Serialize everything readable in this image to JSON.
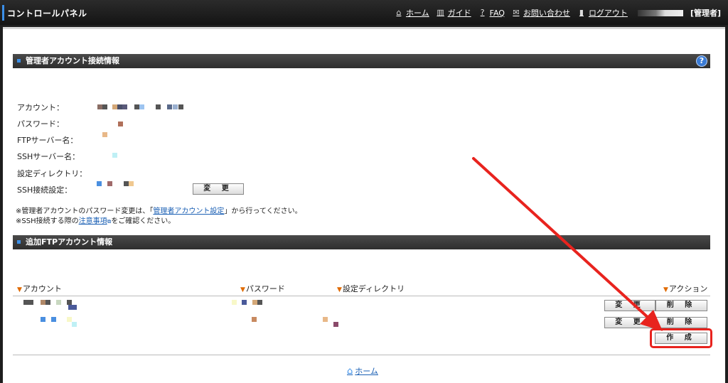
{
  "header": {
    "title": "コントロールパネル",
    "nav": [
      {
        "icon": "home-icon",
        "glyph": "⌂",
        "label": "ホーム"
      },
      {
        "icon": "book-icon",
        "glyph": "▥",
        "label": "ガイド"
      },
      {
        "icon": "help-circle-icon",
        "glyph": "?",
        "label": "FAQ"
      },
      {
        "icon": "mail-icon",
        "glyph": "✉",
        "label": "お問い合わせ"
      },
      {
        "icon": "logout-icon",
        "glyph": "▮",
        "label": "ログアウト"
      }
    ],
    "role": "[管理者]"
  },
  "admin_section": {
    "title": "管理者アカウント接続情報",
    "help_glyph": "?",
    "fields": [
      {
        "label": "アカウント："
      },
      {
        "label": "パスワード："
      },
      {
        "label": "FTPサーバー名："
      },
      {
        "label": "SSHサーバー名："
      },
      {
        "label": "設定ディレクトリ："
      },
      {
        "label": "SSH接続設定："
      }
    ],
    "change_button": "変 更",
    "note1_prefix": "※管理者アカウントのパスワード変更は、「",
    "note1_link": "管理者アカウント設定",
    "note1_suffix": "」から行ってください。",
    "note2_prefix": "※SSH接続する際の",
    "note2_link": "注意事項",
    "note2_suffix": "をご確認ください。"
  },
  "ftp_section": {
    "title": "追加FTPアカウント情報",
    "columns": {
      "account": "アカウント",
      "password": "パスワード",
      "directory": "設定ディレクトリ",
      "action": "アクション"
    },
    "row_buttons": {
      "edit": "変 更",
      "delete": "削 除"
    },
    "create_button": "作 成"
  },
  "footer": {
    "home_label": "ホーム"
  },
  "colors": {
    "annotation_red": "#e8231e",
    "accent_blue": "#3b8fe8"
  }
}
